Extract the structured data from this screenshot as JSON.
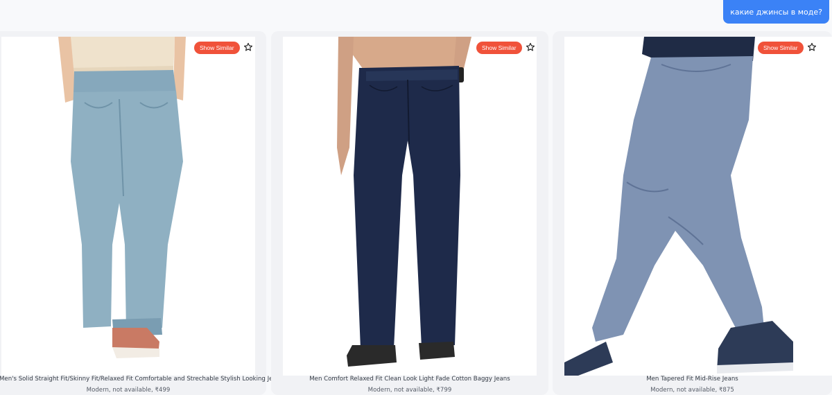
{
  "chat": {
    "user_message": "какие джинсы в моде?",
    "accent_color": "#3b82f6"
  },
  "common": {
    "show_similar_label": "Show Similar",
    "show_similar_color": "#f0523a"
  },
  "products": [
    {
      "title": "Men's Solid Straight Fit/Skinny Fit/Relaxed Fit Comfortable and Strechable Stylish Looking Jeans",
      "meta": "Modern, not available, ₹499",
      "denim_color": "#8fb0c2",
      "icon": "star-outline-icon"
    },
    {
      "title": "Men Comfort Relaxed Fit Clean Look Light Fade Cotton Baggy Jeans",
      "meta": "Modern, not available, ₹799",
      "denim_color": "#1e2a4a",
      "icon": "star-outline-icon"
    },
    {
      "title": "Men Tapered Fit Mid-Rise Jeans",
      "meta": "Modern, not available, ₹875",
      "denim_color": "#7f93b3",
      "icon": "star-outline-icon"
    }
  ]
}
